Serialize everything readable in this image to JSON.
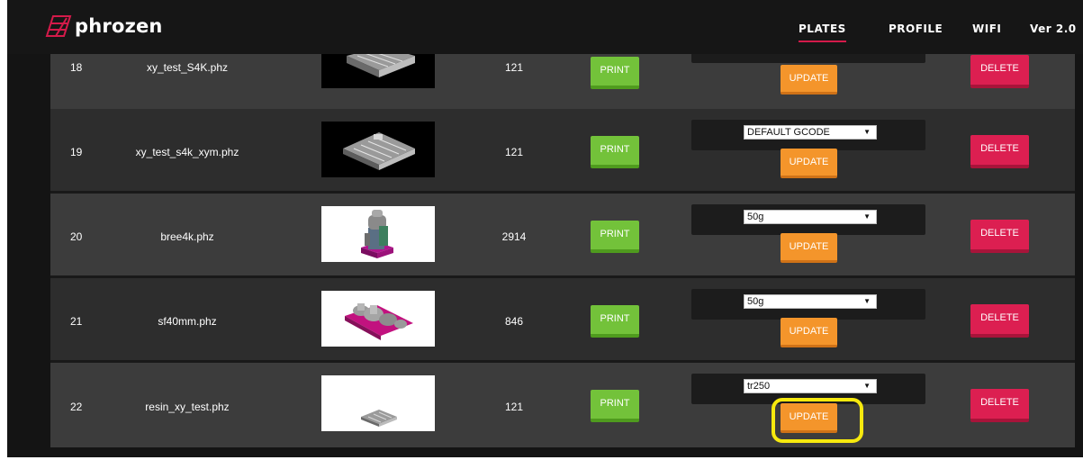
{
  "header": {
    "brand": "phrozen",
    "nav": {
      "plates": "PLATES",
      "profile": "PROFILE",
      "wifi": "WIFI"
    },
    "version": "Ver 2.0",
    "active_tab": "PLATES",
    "accent_color": "#d41a4a"
  },
  "buttons": {
    "print": "PRINT",
    "update": "UPDATE",
    "delete": "DELETE"
  },
  "colors": {
    "print": "#73c23a",
    "update": "#f4952b",
    "delete": "#dc1f51",
    "highlight": "#f6e90e"
  },
  "rows": [
    {
      "number": "18",
      "filename": "xy_test_S4K.phz",
      "layers": "121",
      "gcode": "",
      "thumb": "dark"
    },
    {
      "number": "19",
      "filename": "xy_test_s4k_xym.phz",
      "layers": "121",
      "gcode": "DEFAULT GCODE",
      "thumb": "dark"
    },
    {
      "number": "20",
      "filename": "bree4k.phz",
      "layers": "2914",
      "gcode": "50g",
      "thumb": "light"
    },
    {
      "number": "21",
      "filename": "sf40mm.phz",
      "layers": "846",
      "gcode": "50g",
      "thumb": "light"
    },
    {
      "number": "22",
      "filename": "resin_xy_test.phz",
      "layers": "121",
      "gcode": "tr250",
      "thumb": "light"
    }
  ]
}
